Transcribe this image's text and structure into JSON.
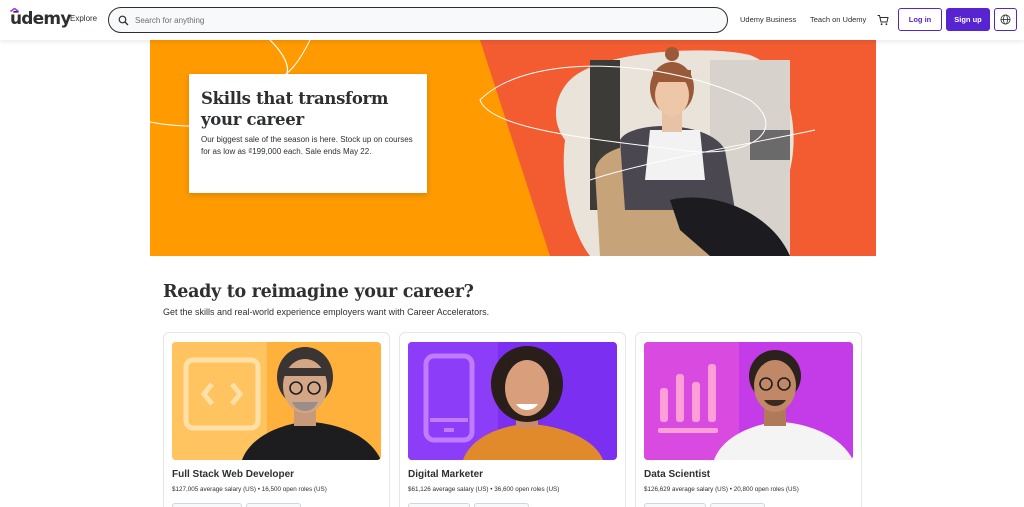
{
  "header": {
    "logo_text": "ūdemy",
    "explore_label": "Explore",
    "search_placeholder": "Search for anything",
    "business_link": "Udemy Business",
    "teach_link": "Teach on Udemy",
    "login_label": "Log in",
    "signup_label": "Sign up",
    "brand_color": "#5624d0"
  },
  "hero": {
    "title": "Skills that transform your career",
    "text": "Our biggest sale of the season is here. Stock up on courses for as low as ₫199,000 each. Sale ends May 22.",
    "bg_orange": "#ff9a00",
    "bg_red": "#f25c30"
  },
  "section": {
    "title": "Ready to reimagine your career?",
    "subtitle": "Get the skills and real-world experience employers want with Career Accelerators."
  },
  "cards": [
    {
      "title": "Full Stack Web Developer",
      "meta": "$127,005 average salary (US) • 16,500 open roles (US)",
      "icon": "code-icon",
      "bg": "#ffb13b"
    },
    {
      "title": "Digital Marketer",
      "meta": "$61,126 average salary (US) • 36,600 open roles (US)",
      "icon": "phone-icon",
      "bg": "#7b2ff0"
    },
    {
      "title": "Data Scientist",
      "meta": "$126,629 average salary (US) • 20,800 open roles (US)",
      "icon": "bar-chart-icon",
      "bg": "#c43ce8"
    }
  ]
}
